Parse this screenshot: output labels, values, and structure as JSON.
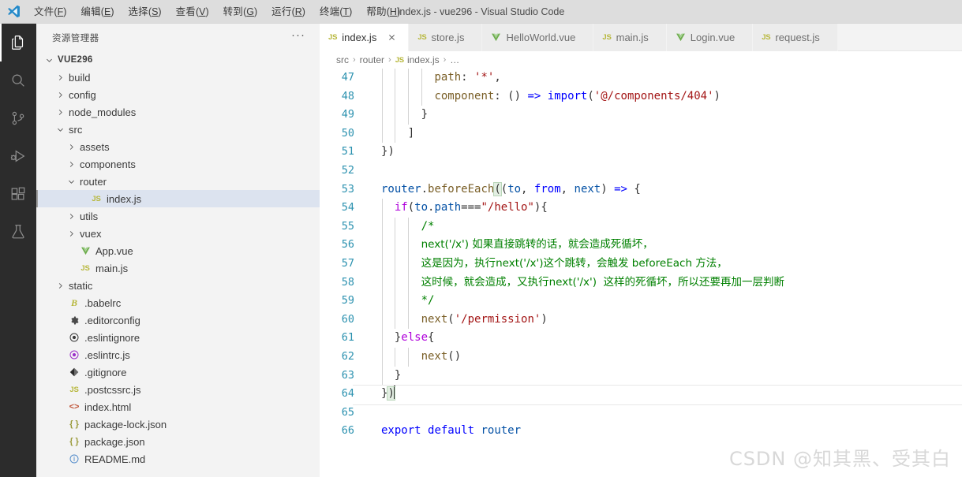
{
  "window": {
    "title": "index.js - vue296 - Visual Studio Code",
    "logo_icon": "vscode-logo-icon"
  },
  "menubar": {
    "items": [
      {
        "label": "文件",
        "mnemonic": "F"
      },
      {
        "label": "编辑",
        "mnemonic": "E"
      },
      {
        "label": "选择",
        "mnemonic": "S"
      },
      {
        "label": "查看",
        "mnemonic": "V"
      },
      {
        "label": "转到",
        "mnemonic": "G"
      },
      {
        "label": "运行",
        "mnemonic": "R"
      },
      {
        "label": "终端",
        "mnemonic": "T"
      },
      {
        "label": "帮助",
        "mnemonic": "H"
      }
    ]
  },
  "activitybar": {
    "items": [
      {
        "name": "explorer-icon",
        "active": true
      },
      {
        "name": "search-icon",
        "active": false
      },
      {
        "name": "source-control-icon",
        "active": false
      },
      {
        "name": "run-and-debug-icon",
        "active": false
      },
      {
        "name": "extensions-icon",
        "active": false
      },
      {
        "name": "testing-flask-icon",
        "active": false
      }
    ]
  },
  "sidebar": {
    "title": "资源管理器",
    "actions_label": "···",
    "tree": [
      {
        "label": "VUE296",
        "depth": 0,
        "type": "root",
        "state": "expanded",
        "icon": "none"
      },
      {
        "label": "build",
        "depth": 1,
        "type": "folder",
        "state": "collapsed",
        "icon": "none"
      },
      {
        "label": "config",
        "depth": 1,
        "type": "folder",
        "state": "collapsed",
        "icon": "none"
      },
      {
        "label": "node_modules",
        "depth": 1,
        "type": "folder",
        "state": "collapsed",
        "icon": "none"
      },
      {
        "label": "src",
        "depth": 1,
        "type": "folder",
        "state": "expanded",
        "icon": "none"
      },
      {
        "label": "assets",
        "depth": 2,
        "type": "folder",
        "state": "collapsed",
        "icon": "none"
      },
      {
        "label": "components",
        "depth": 2,
        "type": "folder",
        "state": "collapsed",
        "icon": "none"
      },
      {
        "label": "router",
        "depth": 2,
        "type": "folder",
        "state": "expanded",
        "icon": "none"
      },
      {
        "label": "index.js",
        "depth": 3,
        "type": "file",
        "state": "none",
        "icon": "js-icon",
        "selected": true
      },
      {
        "label": "utils",
        "depth": 2,
        "type": "folder",
        "state": "collapsed",
        "icon": "none"
      },
      {
        "label": "vuex",
        "depth": 2,
        "type": "folder",
        "state": "collapsed",
        "icon": "none"
      },
      {
        "label": "App.vue",
        "depth": 2,
        "type": "file",
        "state": "none",
        "icon": "vue-icon"
      },
      {
        "label": "main.js",
        "depth": 2,
        "type": "file",
        "state": "none",
        "icon": "js-icon"
      },
      {
        "label": "static",
        "depth": 1,
        "type": "folder",
        "state": "collapsed",
        "icon": "none"
      },
      {
        "label": ".babelrc",
        "depth": 1,
        "type": "file",
        "state": "none",
        "icon": "babel-icon"
      },
      {
        "label": ".editorconfig",
        "depth": 1,
        "type": "file",
        "state": "none",
        "icon": "gear-icon"
      },
      {
        "label": ".eslintignore",
        "depth": 1,
        "type": "file",
        "state": "none",
        "icon": "eslint-dark-icon"
      },
      {
        "label": ".eslintrc.js",
        "depth": 1,
        "type": "file",
        "state": "none",
        "icon": "eslint-icon"
      },
      {
        "label": ".gitignore",
        "depth": 1,
        "type": "file",
        "state": "none",
        "icon": "git-icon"
      },
      {
        "label": ".postcssrc.js",
        "depth": 1,
        "type": "file",
        "state": "none",
        "icon": "js-icon"
      },
      {
        "label": "index.html",
        "depth": 1,
        "type": "file",
        "state": "none",
        "icon": "html-icon"
      },
      {
        "label": "package-lock.json",
        "depth": 1,
        "type": "file",
        "state": "none",
        "icon": "json-icon"
      },
      {
        "label": "package.json",
        "depth": 1,
        "type": "file",
        "state": "none",
        "icon": "json-icon"
      },
      {
        "label": "README.md",
        "depth": 1,
        "type": "file",
        "state": "none",
        "icon": "info-icon"
      }
    ]
  },
  "editor": {
    "tabs": [
      {
        "label": "index.js",
        "icon": "js-icon",
        "active": true,
        "close_label": "×"
      },
      {
        "label": "store.js",
        "icon": "js-icon",
        "active": false
      },
      {
        "label": "HelloWorld.vue",
        "icon": "vue-icon",
        "active": false
      },
      {
        "label": "main.js",
        "icon": "js-icon",
        "active": false
      },
      {
        "label": "Login.vue",
        "icon": "vue-icon",
        "active": false
      },
      {
        "label": "request.js",
        "icon": "js-icon",
        "active": false
      }
    ],
    "breadcrumb": [
      {
        "label": "src",
        "icon": "none"
      },
      {
        "label": "router",
        "icon": "none"
      },
      {
        "label": "index.js",
        "icon": "js-icon"
      },
      {
        "label": "…",
        "icon": "none"
      }
    ],
    "breadcrumb_separator": "›",
    "first_visible_line": 47,
    "last_visible_line": 66,
    "current_line": 64,
    "code_lines": [
      {
        "n": 47,
        "text": "        path: '*',"
      },
      {
        "n": 48,
        "text": "        component: () => import('@/components/404')"
      },
      {
        "n": 49,
        "text": "      }"
      },
      {
        "n": 50,
        "text": "    ]"
      },
      {
        "n": 51,
        "text": "})"
      },
      {
        "n": 52,
        "text": ""
      },
      {
        "n": 53,
        "text": "router.beforeEach((to, from, next) => {"
      },
      {
        "n": 54,
        "text": "  if(to.path===\"/hello\"){"
      },
      {
        "n": 55,
        "text": "      /*"
      },
      {
        "n": 56,
        "text": "      next('/x') 如果直接跳转的话，就会造成死循坏，"
      },
      {
        "n": 57,
        "text": "      这是因为，执行next('/x')这个跳转，会触发 beforeEach 方法，"
      },
      {
        "n": 58,
        "text": "      这时候，就会造成，又执行next('/x')  这样的死循坏，所以还要再加一层判断"
      },
      {
        "n": 59,
        "text": "      */"
      },
      {
        "n": 60,
        "text": "      next('/permission')"
      },
      {
        "n": 61,
        "text": "  }else{"
      },
      {
        "n": 62,
        "text": "      next()"
      },
      {
        "n": 63,
        "text": "  }"
      },
      {
        "n": 64,
        "text": "})"
      },
      {
        "n": 65,
        "text": ""
      },
      {
        "n": 66,
        "text": "export default router"
      }
    ]
  },
  "watermark": {
    "text": "CSDN @知其黑、受其白"
  },
  "colors": {
    "titlebar_bg": "#dddddd",
    "activitybar_bg": "#2c2c2c",
    "sidebar_bg": "#f3f3f3",
    "editor_bg": "#ffffff",
    "tab_active_bg": "#ffffff",
    "tab_inactive_bg": "#ececec",
    "selection_bg": "#dce3ef",
    "line_number": "#2b91af",
    "keyword": "#0000ff",
    "control_keyword": "#af00db",
    "string": "#a31515",
    "comment": "#008000",
    "function": "#795e26",
    "variable": "#001080",
    "js_icon": "#b7b73b",
    "vue_icon": "#6fae4f"
  }
}
